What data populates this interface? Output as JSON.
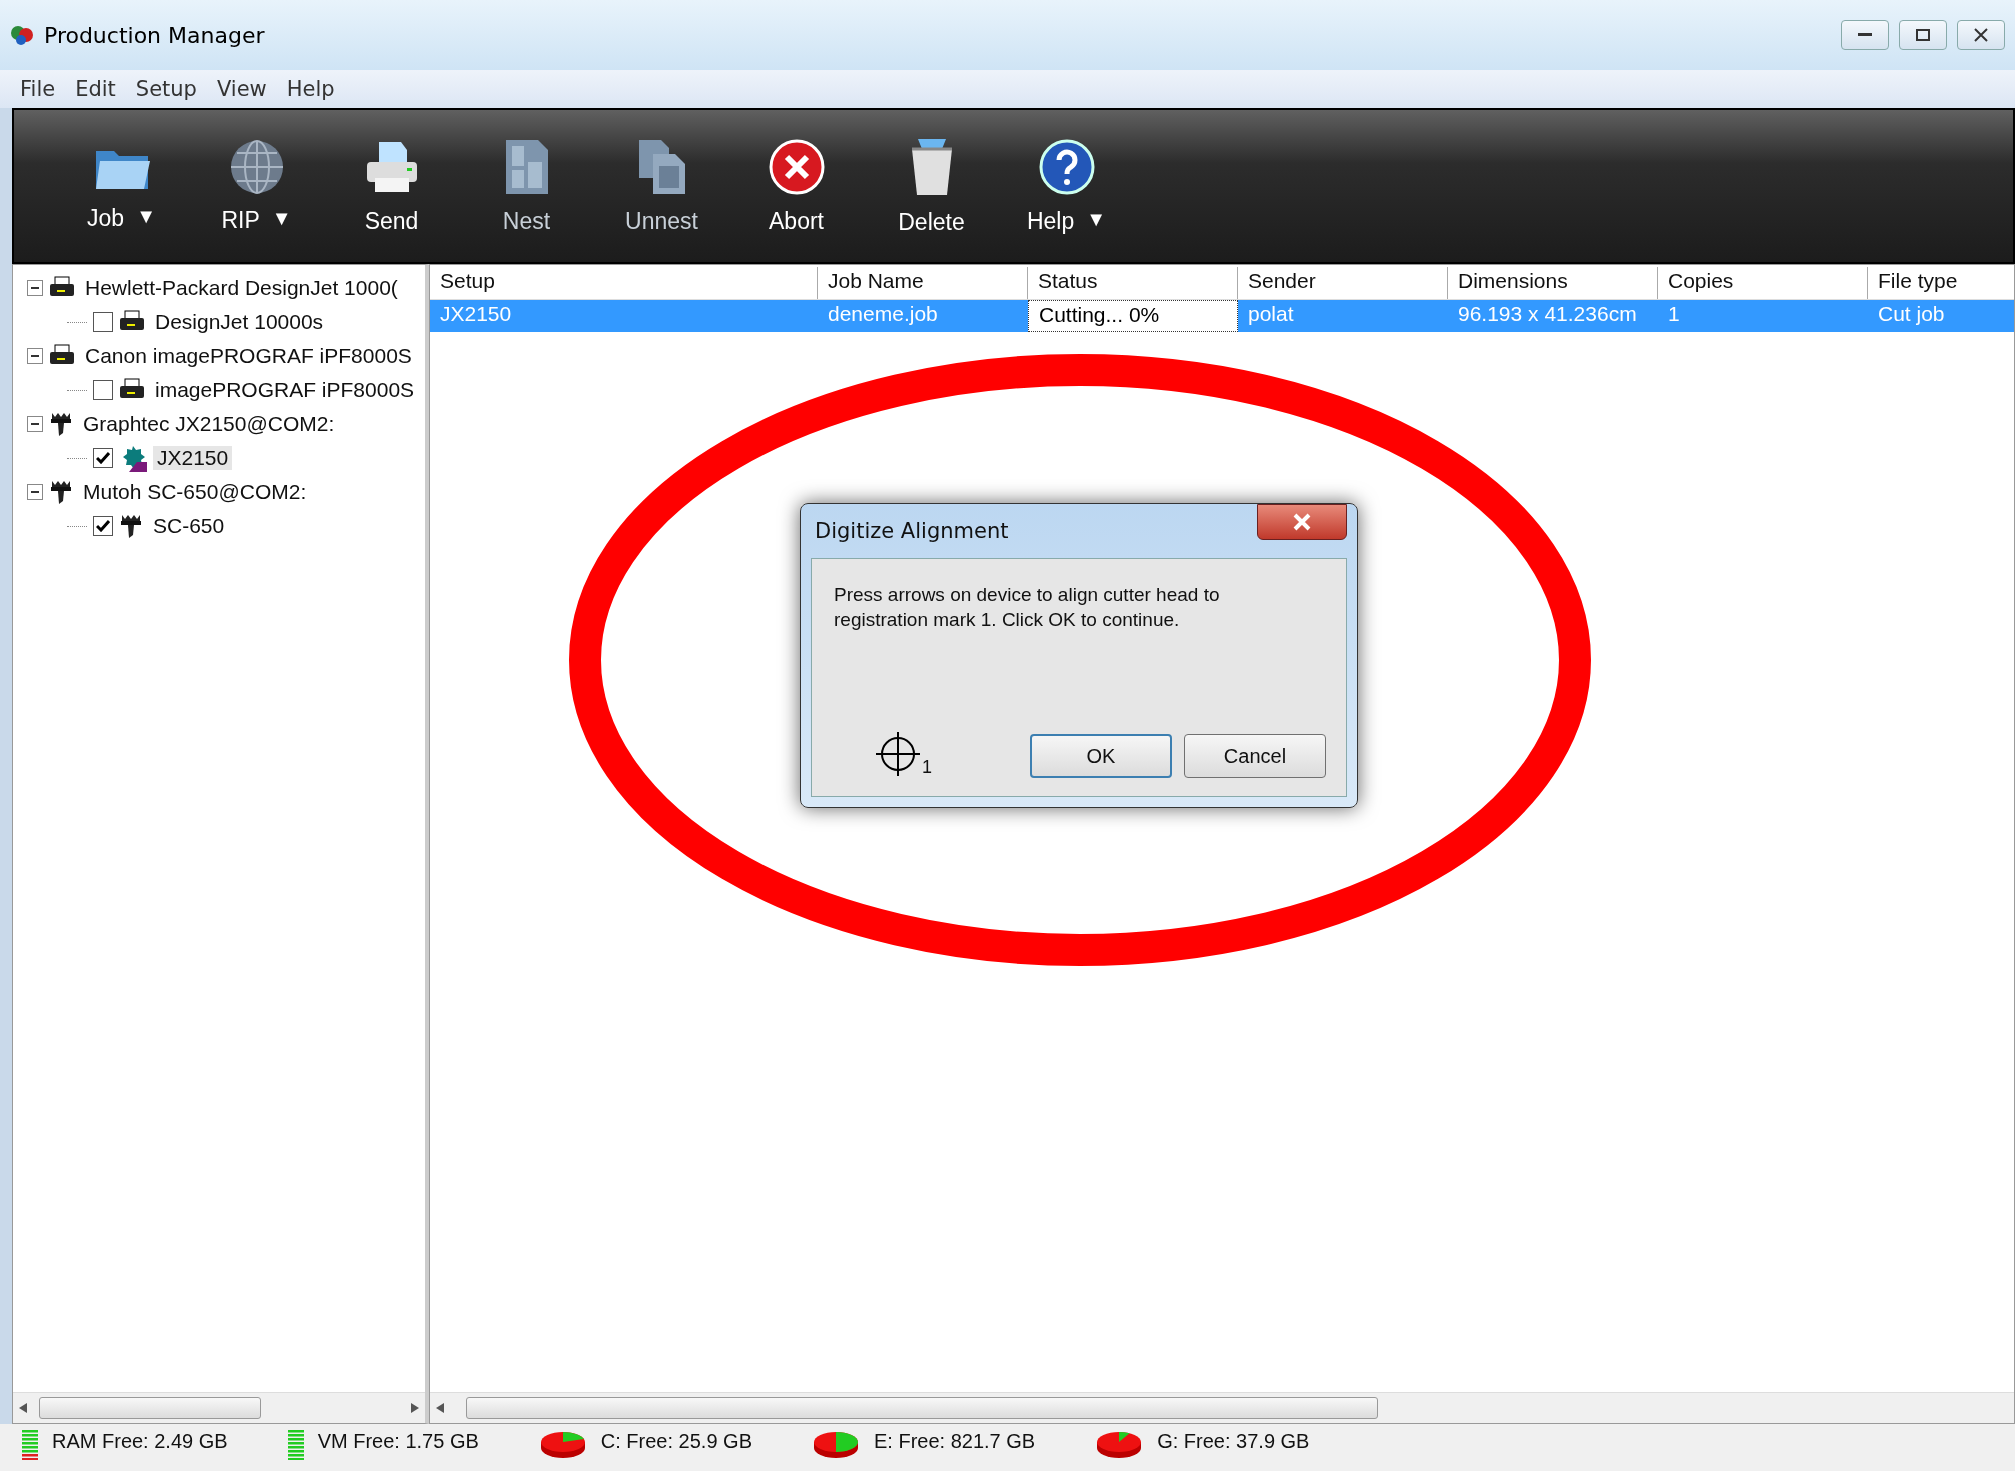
{
  "window": {
    "title": "Production Manager"
  },
  "menu": [
    "File",
    "Edit",
    "Setup",
    "View",
    "Help"
  ],
  "toolbar": [
    {
      "label": "Job",
      "arrow": "▼",
      "disabled": false
    },
    {
      "label": "RIP",
      "arrow": "▼",
      "disabled": false
    },
    {
      "label": "Send",
      "disabled": false
    },
    {
      "label": "Nest",
      "disabled": true
    },
    {
      "label": "Unnest",
      "disabled": true
    },
    {
      "label": "Abort",
      "disabled": false
    },
    {
      "label": "Delete",
      "disabled": false
    },
    {
      "label": "Help",
      "arrow": "▼",
      "disabled": false
    }
  ],
  "tree": [
    {
      "label": "Hewlett-Packard DesignJet 1000(",
      "kind": "printer",
      "expanded": true,
      "children": [
        {
          "label": "DesignJet 10000s",
          "kind": "printer",
          "checked": false,
          "selected": false
        }
      ]
    },
    {
      "label": "Canon imagePROGRAF iPF8000S",
      "kind": "printer",
      "expanded": true,
      "children": [
        {
          "label": "imagePROGRAF iPF8000S",
          "kind": "printer",
          "checked": false,
          "selected": false
        }
      ]
    },
    {
      "label": "Graphtec JX2150@COM2:",
      "kind": "cutter",
      "expanded": true,
      "children": [
        {
          "label": "JX2150",
          "kind": "gear",
          "checked": true,
          "selected": true
        }
      ]
    },
    {
      "label": "Mutoh SC-650@COM2:",
      "kind": "cutter",
      "expanded": true,
      "children": [
        {
          "label": "SC-650",
          "kind": "cutter",
          "checked": true,
          "selected": false
        }
      ]
    }
  ],
  "table": {
    "columns": [
      "Setup",
      "Job Name",
      "Status",
      "Sender",
      "Dimensions",
      "Copies",
      "File type"
    ],
    "rows": [
      {
        "cells": [
          "JX2150",
          "deneme.job",
          "Cutting... 0%",
          "polat",
          "96.193 x 41.236cm",
          "1",
          "Cut job"
        ],
        "selected": true
      }
    ]
  },
  "dialog": {
    "title": "Digitize Alignment",
    "message": "Press arrows on device to align cutter head to registration mark 1. Click OK to continue.",
    "mark_label": "1",
    "buttons": [
      {
        "label": "OK",
        "default": true
      },
      {
        "label": "Cancel",
        "default": false
      }
    ]
  },
  "annotation": {
    "kind": "ellipse",
    "color": "#ff0000"
  },
  "status_bar": [
    {
      "kind": "bars",
      "text": "RAM Free: 2.49 GB"
    },
    {
      "kind": "bars",
      "text": "VM Free: 1.75 GB"
    },
    {
      "kind": "pie",
      "text": "C: Free: 25.9 GB"
    },
    {
      "kind": "pie",
      "text": "E: Free: 821.7 GB"
    },
    {
      "kind": "pie",
      "text": "G: Free: 37.9 GB"
    }
  ]
}
